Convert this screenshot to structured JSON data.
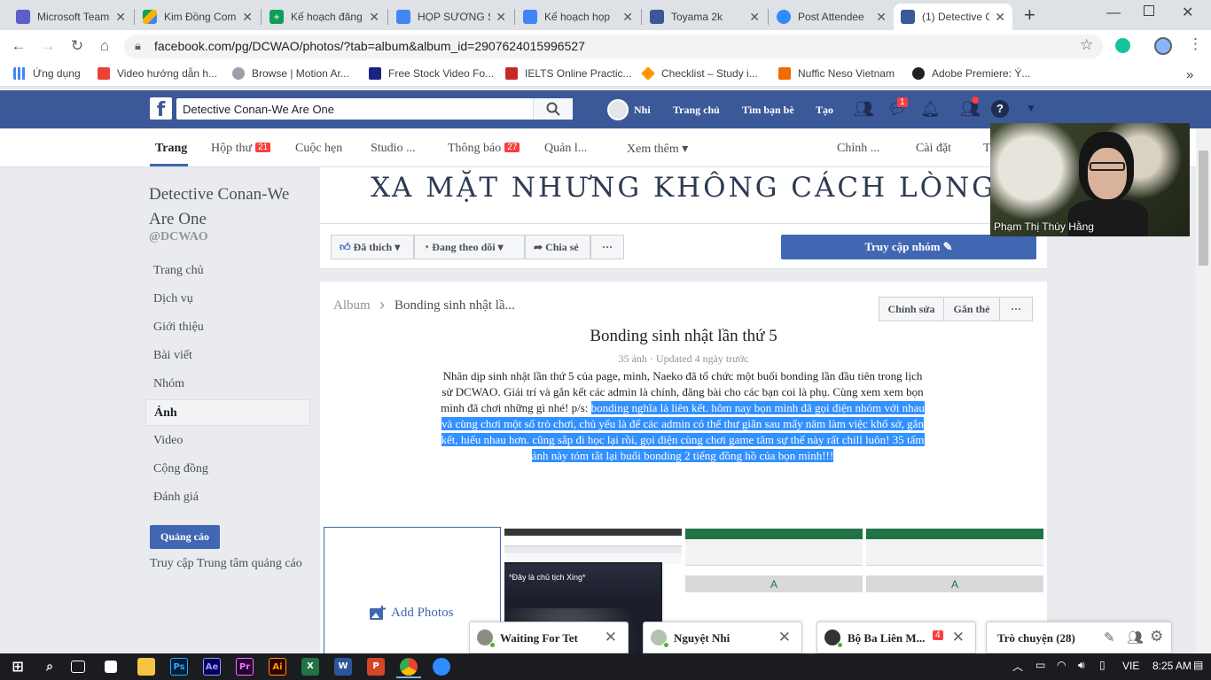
{
  "browser": {
    "tabs": [
      {
        "title": "Microsoft Teams",
        "color": "#5b5fc7"
      },
      {
        "title": "Kim Đồng Comics",
        "color": "#f4b400"
      },
      {
        "title": "Kế hoạch đăng bài",
        "color": "#0f9d58"
      },
      {
        "title": "HỌP SƯƠNG S",
        "color": "#4285f4"
      },
      {
        "title": "Kế hoạch họp",
        "color": "#4285f4"
      },
      {
        "title": "Toyama 2k",
        "color": "#3b5998"
      },
      {
        "title": "Post Attendee",
        "color": "#2d8cff"
      },
      {
        "title": "(1) Detective C",
        "color": "#3b5998"
      }
    ],
    "new_tab": "+",
    "url": "facebook.com/pg/DCWAO/photos/?tab=album&album_id=2907624015996527",
    "bookmarks": [
      {
        "label": "Ứng dụng"
      },
      {
        "label": "Video hướng dẫn h..."
      },
      {
        "label": "Browse | Motion Ar..."
      },
      {
        "label": "Free Stock Video Fo..."
      },
      {
        "label": "IELTS Online Practic..."
      },
      {
        "label": "Checklist – Study i..."
      },
      {
        "label": "Nuffic Neso Vietnam"
      },
      {
        "label": "Adobe Premiere: Ý..."
      }
    ],
    "more_bookmarks": "»"
  },
  "fb": {
    "logo": "f",
    "search_value": "Detective Conan-We Are One",
    "user_name": "Nhi",
    "nav": [
      "Trang chủ",
      "Tìm bạn bè",
      "Tạo"
    ],
    "messenger_count": "1"
  },
  "page_tabs": [
    {
      "label": "Trang",
      "badge": ""
    },
    {
      "label": "Hộp thư",
      "badge": "21"
    },
    {
      "label": "Cuộc hẹn",
      "badge": ""
    },
    {
      "label": "Studio ...",
      "badge": ""
    },
    {
      "label": "Thông báo",
      "badge": "27"
    },
    {
      "label": "Quản l...",
      "badge": ""
    },
    {
      "label": "Xem thêm ▾",
      "badge": ""
    },
    {
      "label": "Chỉnh ...",
      "badge": ""
    },
    {
      "label": "Cài đặt",
      "badge": ""
    },
    {
      "label": "T",
      "badge": ""
    }
  ],
  "sidebar": {
    "page_name": "Detective Conan-We Are One",
    "handle": "@DCWAO",
    "items": [
      "Trang chủ",
      "Dịch vụ",
      "Giới thiệu",
      "Bài viết",
      "Nhóm",
      "Ảnh",
      "Video",
      "Cộng đồng",
      "Đánh giá"
    ],
    "active": "Ảnh",
    "promote": "Quảng cáo",
    "ad_center": "Truy cập Trung tâm quảng cáo"
  },
  "cover": {
    "text": "XA MẶT NHƯNG KHÔNG CÁCH LÒNG",
    "liked": "Đã thích",
    "following": "Đang theo dõi",
    "share": "Chia sẻ",
    "more": "···",
    "group_button": "Truy cập nhóm"
  },
  "album": {
    "crumb_root": "Album",
    "crumb_current": "Bonding sinh nhật lầ...",
    "edit": "Chỉnh sửa",
    "tag": "Gắn thẻ",
    "more": "···",
    "title": "Bonding sinh nhật lần thứ 5",
    "meta": "35 ảnh · Updated 4 ngày trước",
    "desc_plain": "Nhân dịp sinh nhật lần thứ 5 của page, mình, Naeko đã tổ chức một buổi bonding lần đầu tiên trong lịch sử DCWAO. Giải trí và gắn kết các admin là chính, đăng bài cho các bạn coi là phụ. Cùng xem xem bọn mình đã chơi những gì nhé! p/s: ",
    "desc_selected": "bonding nghĩa là liên kết. hôm nay bọn mình đã gọi điện nhóm với nhau và cùng chơi một số trò chơi, chủ yếu là để các admin có thể thư giãn sau mấy năm làm việc khổ sở, gắn kết, hiểu nhau hơn. cũng sắp đi học lại rồi, gọi điện cùng chơi game tâm sự thế này rất chill luôn! 35 tấm ảnh này tóm tắt lại buổi bonding 2 tiếng đồng hồ của bọn mình!!!",
    "add_photos": "Add Photos",
    "thumb1_caption": "*Đây là chủ tịch Xing*",
    "thumb_excel_letter": "A"
  },
  "video": {
    "name": "Phạm Thị Thúy Hằng"
  },
  "chats": [
    {
      "name": "Waiting For Tet",
      "badge": ""
    },
    {
      "name": "Nguyệt Nhi",
      "badge": ""
    },
    {
      "name": "Bộ Ba Liên M...",
      "badge": "4"
    }
  ],
  "chat_sidebar": {
    "label": "Trò chuyện (28)"
  },
  "taskbar": {
    "lang": "VIE",
    "time": "8:25 AM"
  }
}
